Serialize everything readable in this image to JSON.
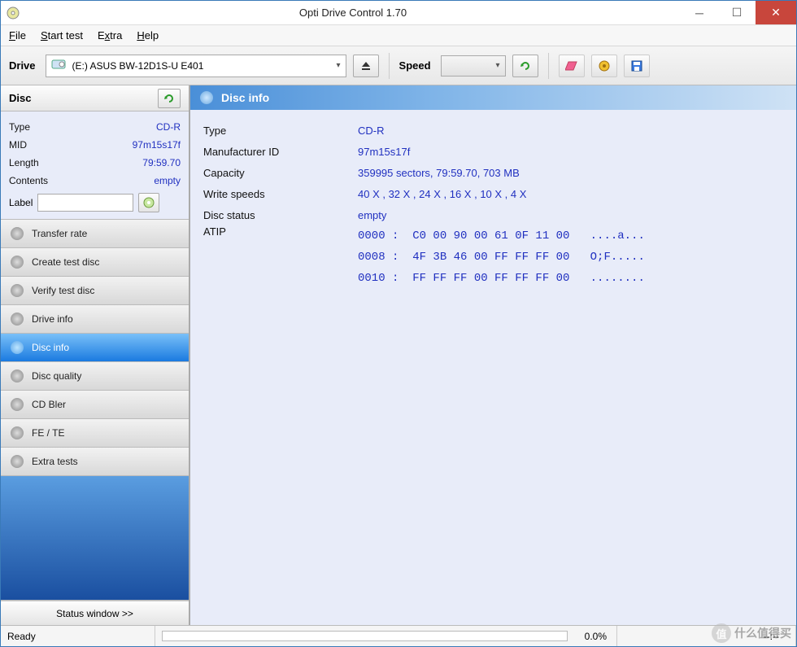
{
  "window": {
    "title": "Opti Drive Control 1.70"
  },
  "menu": {
    "file": "File",
    "start_test": "Start test",
    "extra": "Extra",
    "help": "Help"
  },
  "toolbar": {
    "drive_label": "Drive",
    "drive_value": "(E:)  ASUS BW-12D1S-U E401",
    "speed_label": "Speed"
  },
  "sidebar": {
    "disc_header": "Disc",
    "rows": [
      {
        "k": "Type",
        "v": "CD-R"
      },
      {
        "k": "MID",
        "v": "97m15s17f"
      },
      {
        "k": "Length",
        "v": "79:59.70"
      },
      {
        "k": "Contents",
        "v": "empty"
      }
    ],
    "label_label": "Label",
    "label_value": "",
    "items": [
      "Transfer rate",
      "Create test disc",
      "Verify test disc",
      "Drive info",
      "Disc info",
      "Disc quality",
      "CD Bler",
      "FE / TE",
      "Extra tests"
    ],
    "active_index": 4,
    "status_window": "Status window >>"
  },
  "content": {
    "header": "Disc info",
    "rows": [
      {
        "k": "Type",
        "v": "CD-R"
      },
      {
        "k": "Manufacturer ID",
        "v": "97m15s17f"
      },
      {
        "k": "Capacity",
        "v": "359995 sectors, 79:59.70, 703 MB"
      },
      {
        "k": "Write speeds",
        "v": "40 X , 32 X , 24 X , 16 X , 10 X , 4 X"
      },
      {
        "k": "Disc status",
        "v": "empty"
      }
    ],
    "atip_label": "ATIP",
    "atip": [
      "0000 :  C0 00 90 00 61 0F 11 00   ....a...",
      "0008 :  4F 3B 46 00 FF FF FF 00   O;F.....",
      "0010 :  FF FF FF 00 FF FF FF 00   ........"
    ]
  },
  "statusbar": {
    "ready": "Ready",
    "pct": "0.0%",
    "time": "--:--"
  },
  "watermark": "什么值得买"
}
